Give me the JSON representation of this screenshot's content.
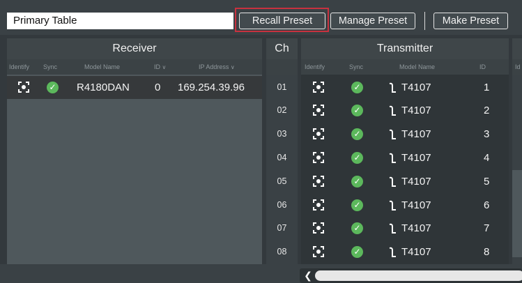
{
  "toolbar": {
    "preset_name": "Primary Table",
    "recall_label": "Recall Preset",
    "manage_label": "Manage Preset",
    "make_label": "Make Preset"
  },
  "receiver": {
    "title": "Receiver",
    "columns": [
      "Identify",
      "Sync",
      "Model Name",
      "ID",
      "IP Address"
    ],
    "row": {
      "model": "R4180DAN",
      "id": "0",
      "ip": "169.254.39.96"
    }
  },
  "channel": {
    "title": "Ch",
    "rows": [
      "01",
      "02",
      "03",
      "04",
      "05",
      "06",
      "07",
      "08"
    ]
  },
  "transmitter": {
    "title": "Transmitter",
    "columns": [
      "Identify",
      "Sync",
      "Model Name",
      "ID",
      "Id"
    ],
    "rows": [
      {
        "model": "T4107",
        "id": "1"
      },
      {
        "model": "T4107",
        "id": "2"
      },
      {
        "model": "T4107",
        "id": "3"
      },
      {
        "model": "T4107",
        "id": "4"
      },
      {
        "model": "T4107",
        "id": "5"
      },
      {
        "model": "T4107",
        "id": "6"
      },
      {
        "model": "T4107",
        "id": "7"
      },
      {
        "model": "T4107",
        "id": "8"
      }
    ]
  },
  "icons": {
    "identify": "identify-icon",
    "sync": "sync-check-icon",
    "mic": "headset-mic-icon",
    "chevron": "chevron-down-icon",
    "scroll_left": "scroll-left-icon"
  },
  "colors": {
    "sync_ok": "#5cb85c",
    "highlight": "#c8323f"
  }
}
